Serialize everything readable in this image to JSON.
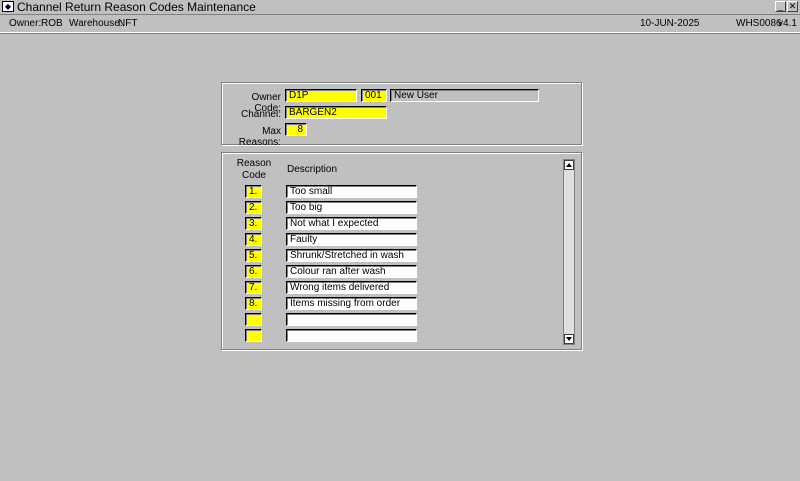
{
  "window": {
    "title": "Channel Return Reason Codes Maintenance",
    "minimize_label": "_",
    "close_label": "✕"
  },
  "info": {
    "owner_label": "Owner:",
    "owner_value": "ROB",
    "warehouse_label": "Warehouse:",
    "warehouse_value": "NFT",
    "date": "10-JUN-2025",
    "screen_id": "WHS0086",
    "version": "v4.1"
  },
  "header": {
    "owner_code_label": "Owner Code:",
    "owner_code_value": "D1P",
    "owner_num": "001",
    "owner_name": "New User",
    "channel_label": "Channel:",
    "channel_value": "BARGEN2",
    "max_reasons_label": "Max Reasons:",
    "max_reasons_value": "8"
  },
  "table": {
    "col_reason_line1": "Reason",
    "col_reason_line2": "Code",
    "col_description": "Description",
    "rows": [
      {
        "code": "1.",
        "description": "Too small"
      },
      {
        "code": "2.",
        "description": "Too big"
      },
      {
        "code": "3.",
        "description": "Not what I expected"
      },
      {
        "code": "4.",
        "description": "Faulty"
      },
      {
        "code": "5.",
        "description": "Shrunk/Stretched in wash"
      },
      {
        "code": "6.",
        "description": "Colour ran after wash"
      },
      {
        "code": "7.",
        "description": "Wrong items delivered"
      },
      {
        "code": "8.",
        "description": "Items missing from order"
      },
      {
        "code": "",
        "description": ""
      },
      {
        "code": "",
        "description": ""
      }
    ]
  },
  "colors": {
    "background": "#c0c0c0",
    "required_field": "#ffff00",
    "text_field": "#ffffff"
  },
  "icons": {
    "scroll_up": "triangle-up-icon",
    "scroll_down": "triangle-down-icon"
  }
}
